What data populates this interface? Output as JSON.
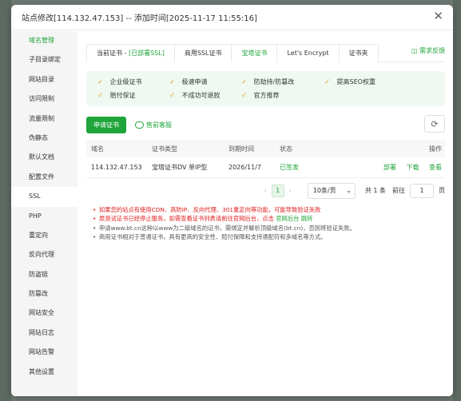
{
  "dialog": {
    "title": "站点修改[114.132.47.153] -- 添加时间[2025-11-17 11:55:16]",
    "close_glyph": "✕"
  },
  "sidebar": {
    "items": [
      {
        "label": "域名管理"
      },
      {
        "label": "子目录绑定"
      },
      {
        "label": "网站目录"
      },
      {
        "label": "访问限制"
      },
      {
        "label": "流量限制"
      },
      {
        "label": "伪静态"
      },
      {
        "label": "默认文档"
      },
      {
        "label": "配置文件"
      },
      {
        "label": "SSL"
      },
      {
        "label": "PHP"
      },
      {
        "label": "重定向"
      },
      {
        "label": "反向代理"
      },
      {
        "label": "防盗链"
      },
      {
        "label": "防篡改"
      },
      {
        "label": "网站安全"
      },
      {
        "label": "网站日志"
      },
      {
        "label": "网站告警"
      },
      {
        "label": "其他设置"
      }
    ]
  },
  "tabs": {
    "current_prefix": "当前证书 - ",
    "current_status": "[已部署SSL]",
    "commercial": "商用SSL证书",
    "baota": "宝塔证书",
    "letsencrypt": "Let's Encrypt",
    "folder": "证书夹",
    "feedback": "需求反馈"
  },
  "features": [
    "企业级证书",
    "极速申请",
    "防劫持/防篡改",
    "提高SEO权重",
    "赔付保证",
    "不成功可退款",
    "官方推荐"
  ],
  "actions": {
    "apply": "申请证书",
    "support": "售前客服",
    "refresh_glyph": "⟳"
  },
  "table": {
    "headers": {
      "domain": "域名",
      "type": "证书类型",
      "expire": "到期时间",
      "status": "状态",
      "ops": "操作"
    },
    "rows": [
      {
        "domain": "114.132.47.153",
        "type": "宝塔证书DV 单IP型",
        "expire": "2026/11/7",
        "status": "已签发",
        "deploy": "部署",
        "download": "下载",
        "view": "查看"
      }
    ]
  },
  "pager": {
    "prev": "‹",
    "current": "1",
    "next": "›",
    "page_size": "10条/页",
    "total": "共 1 条",
    "goto": "前往",
    "goto_value": "1",
    "page_unit": "页"
  },
  "notes": {
    "n1": "如果您的站点有使用CDN、高防IP、反向代理、301重定向等功能，可能导致验证失败",
    "n2_text": "原测试证书已经停止服务，如需查看证书列表请前往官网后台，点击",
    "n2_link1": "官网后台",
    "n2_link2": "跳转",
    "n3": "申请www.bt.cn这种以www为二级域名的证书，需绑定并解析顶级域名(bt.cn)，否则将验证失败。",
    "n4": "商用证书相对于普通证书，具有更高的安全性、赔付保障和支持通配符和多域名等方式。"
  }
}
